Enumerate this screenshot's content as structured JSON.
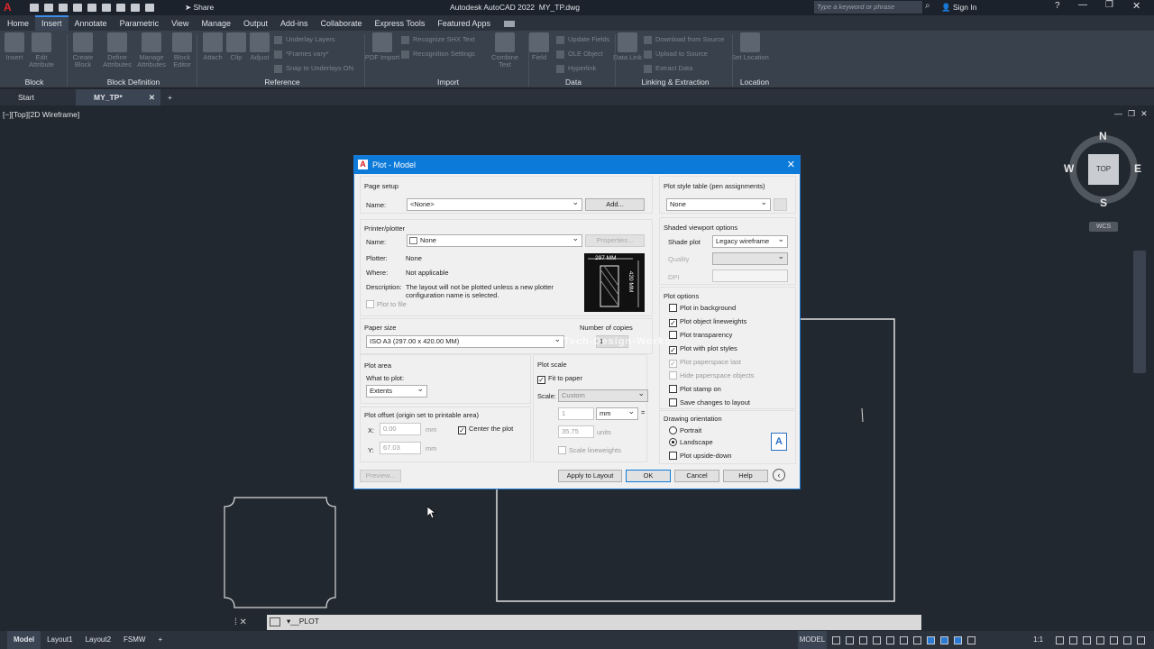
{
  "title_bar": {
    "app_title": "Autodesk AutoCAD 2022",
    "file_name": "MY_TP.dwg",
    "share_label": "Share",
    "search_placeholder": "Type a keyword or phrase",
    "sign_in_label": "Sign In",
    "app_menu_letter": "A"
  },
  "menu_tabs": [
    "Home",
    "Insert",
    "Annotate",
    "Parametric",
    "View",
    "Manage",
    "Output",
    "Add-ins",
    "Collaborate",
    "Express Tools",
    "Featured Apps"
  ],
  "ribbon": {
    "buttons": [
      "Insert",
      "Edit Attribute",
      "Create Block",
      "Define Attributes",
      "Manage Attributes",
      "Block Editor",
      "Attach",
      "Clip",
      "Adjust",
      "PDF Import",
      "Combine Text",
      "Field",
      "Data Link",
      "Set Location"
    ],
    "small_items": [
      "Underlay Layers",
      "*Frames vary*",
      "Snap to Underlays ON",
      "Recognize SHX Text",
      "Recognition Settings",
      "Update Fields",
      "OLE Object",
      "Hyperlink",
      "Download from Source",
      "Upload to Source",
      "Extract Data"
    ],
    "panels": [
      "Block",
      "Block Definition",
      "Reference",
      "Import",
      "Data",
      "Linking & Extraction",
      "Location"
    ]
  },
  "doc_tabs": {
    "start": "Start",
    "active": "MY_TP*",
    "add": "+"
  },
  "viewport_label": "[−][Top][2D Wireframe]",
  "viewcube": {
    "n": "N",
    "s": "S",
    "e": "E",
    "w": "W",
    "top": "TOP",
    "wcs": "WCS"
  },
  "dialog": {
    "title": "Plot - Model",
    "page_setup": {
      "heading": "Page setup",
      "name_label": "Name:",
      "name_value": "<None>",
      "add_button": "Add..."
    },
    "printer": {
      "heading": "Printer/plotter",
      "name_label": "Name:",
      "name_value": "None",
      "properties_button": "Properties...",
      "plotter_label": "Plotter:",
      "plotter_value": "None",
      "where_label": "Where:",
      "where_value": "Not applicable",
      "description_label": "Description:",
      "description_value": "The layout will not be plotted unless a new plotter configuration name is selected.",
      "plot_to_file": "Plot to file",
      "preview_width": "297 MM",
      "preview_height": "420 MM"
    },
    "paper_size": {
      "heading": "Paper size",
      "value": "ISO A3 (297.00 x 420.00 MM)"
    },
    "copies": {
      "label": "Number of copies",
      "value": "1"
    },
    "plot_area": {
      "heading": "Plot area",
      "what_label": "What to plot:",
      "what_value": "Extents"
    },
    "plot_offset": {
      "heading": "Plot offset (origin set to printable area)",
      "x_label": "X:",
      "x_value": "0.00",
      "y_label": "Y:",
      "y_value": "67.03",
      "unit": "mm",
      "center_label": "Center the plot"
    },
    "plot_scale": {
      "heading": "Plot scale",
      "fit_label": "Fit to paper",
      "scale_label": "Scale:",
      "scale_value": "Custom",
      "val1": "1",
      "unit1": "mm",
      "equals": "=",
      "val2": "35.75",
      "unit2": "units",
      "lineweights_label": "Scale lineweights"
    },
    "plot_style": {
      "heading": "Plot style table (pen assignments)",
      "value": "None"
    },
    "shaded": {
      "heading": "Shaded viewport options",
      "shade_label": "Shade plot",
      "shade_value": "Legacy wireframe",
      "quality_label": "Quality",
      "dpi_label": "DPI"
    },
    "plot_options": {
      "heading": "Plot options",
      "items": [
        {
          "label": "Plot in background",
          "checked": false,
          "enabled": true
        },
        {
          "label": "Plot object lineweights",
          "checked": true,
          "enabled": true
        },
        {
          "label": "Plot transparency",
          "checked": false,
          "enabled": true
        },
        {
          "label": "Plot with plot styles",
          "checked": true,
          "enabled": true
        },
        {
          "label": "Plot paperspace last",
          "checked": true,
          "enabled": false
        },
        {
          "label": "Hide paperspace objects",
          "checked": false,
          "enabled": false
        },
        {
          "label": "Plot stamp on",
          "checked": false,
          "enabled": true
        },
        {
          "label": "Save changes to layout",
          "checked": false,
          "enabled": true
        }
      ]
    },
    "orientation": {
      "heading": "Drawing orientation",
      "portrait": "Portrait",
      "landscape": "Landscape",
      "upside_down": "Plot upside-down",
      "selected": "Landscape"
    },
    "buttons": {
      "preview": "Preview...",
      "apply": "Apply to Layout",
      "ok": "OK",
      "cancel": "Cancel",
      "help": "Help"
    },
    "watermark": "Tech-Design-Works"
  },
  "command_line": {
    "prompt": "_PLOT"
  },
  "status_bar": {
    "tabs": [
      "Model",
      "Layout1",
      "Layout2",
      "FSMW"
    ],
    "active_tab": "Model",
    "add": "+",
    "model_label": "MODEL",
    "scale_label": "1:1"
  }
}
